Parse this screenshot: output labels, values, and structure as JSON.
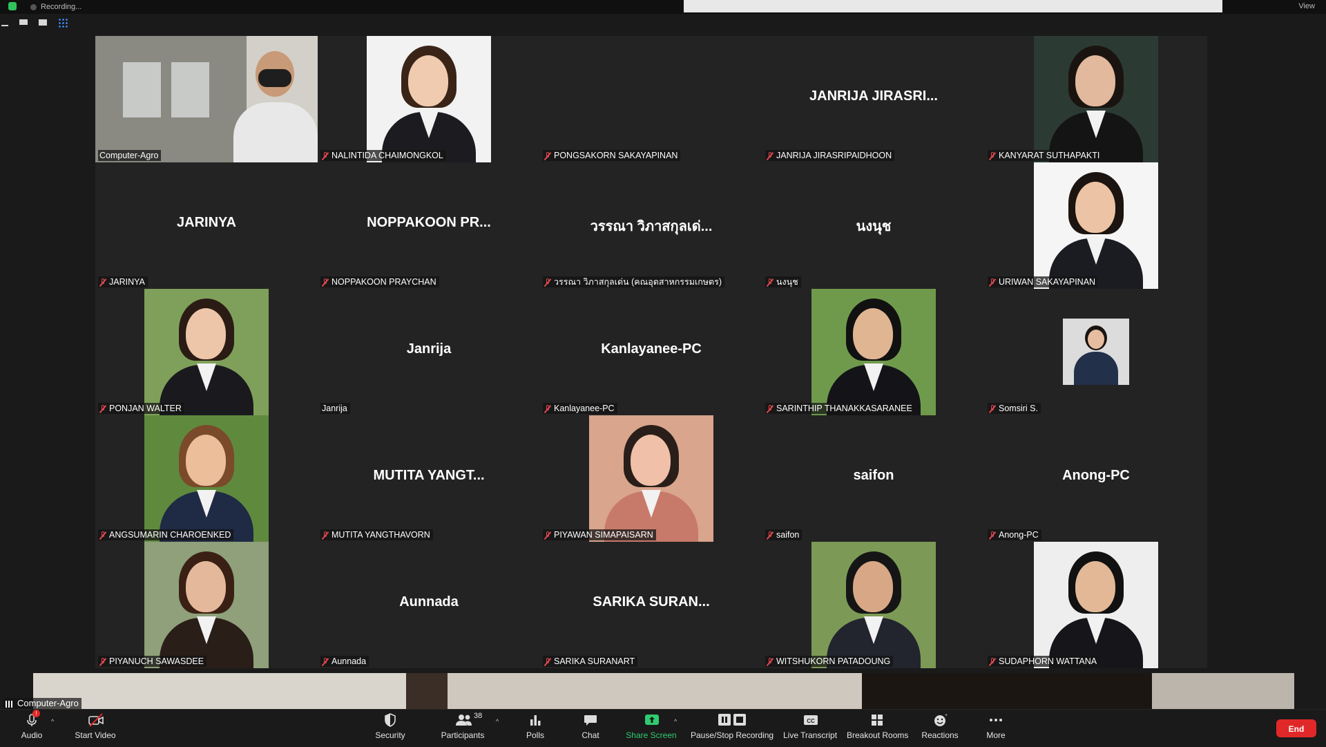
{
  "top": {
    "recording_label": "Recording...",
    "view_label": "View"
  },
  "participants": [
    {
      "name": "Computer-Agro",
      "display": "",
      "video": true,
      "muted": false,
      "active": true,
      "photo": "cctv",
      "pal": [
        "#8a8a82",
        "#3a3a3a",
        "#d7d9da"
      ]
    },
    {
      "name": "NALINTIDA CHAIMONGKOL",
      "display": "",
      "video": true,
      "muted": true,
      "photo": "woman",
      "pal": [
        "#f2f2f2",
        "#1c1c20",
        "#3a2418",
        "#f0cbb0"
      ]
    },
    {
      "name": "PONGSAKORN SAKAYAPINAN",
      "display": "",
      "video": false,
      "muted": true
    },
    {
      "name": "JANRIJA JIRASRIPAIDHOON",
      "display": "JANRIJA  JIRASRI...",
      "video": false,
      "muted": true
    },
    {
      "name": "KANYARAT SUTHAPAKTI",
      "display": "",
      "video": true,
      "muted": true,
      "photo": "woman",
      "pal": [
        "#2c3a34",
        "#141414",
        "#1a1410",
        "#e2b99c"
      ]
    },
    {
      "name": "JARINYA",
      "display": "JARINYA",
      "video": false,
      "muted": true
    },
    {
      "name": "NOPPAKOON PRAYCHAN",
      "display": "NOPPAKOON  PR...",
      "video": false,
      "muted": true
    },
    {
      "name": "วรรณา วิภาสกุลเด่น (คณอุตสาหกรรมเกษตร)",
      "display": "วรรณา  วิภาสกุลเด่...",
      "video": false,
      "muted": true
    },
    {
      "name": "นงนุช",
      "display": "นงนุช",
      "video": false,
      "muted": true
    },
    {
      "name": "URIWAN SAKAYAPINAN",
      "display": "",
      "video": true,
      "muted": true,
      "photo": "woman",
      "pal": [
        "#f5f5f5",
        "#1b1c22",
        "#1b1410",
        "#ecc3a4"
      ]
    },
    {
      "name": "PONJAN WALTER",
      "display": "",
      "video": true,
      "muted": true,
      "photo": "woman",
      "pal": [
        "#7fa05a",
        "#1a1a1e",
        "#2a1c14",
        "#edc5a8"
      ]
    },
    {
      "name": "Janrija",
      "display": "Janrija",
      "video": false,
      "muted": false
    },
    {
      "name": "Kanlayanee-PC",
      "display": "Kanlayanee-PC",
      "video": false,
      "muted": true
    },
    {
      "name": "SARINTHIP THANAKKASARANEE",
      "display": "",
      "video": true,
      "muted": true,
      "photo": "woman",
      "pal": [
        "#6f9a4c",
        "#141418",
        "#111",
        "#e0b592"
      ]
    },
    {
      "name": "Somsiri S.",
      "display": "",
      "video": true,
      "muted": true,
      "photo": "small",
      "pal": [
        "#dcdcdc",
        "#22304a",
        "#1a1410",
        "#e6bda0"
      ]
    },
    {
      "name": "ANGSUMARIN CHAROENKED",
      "display": "",
      "video": true,
      "muted": true,
      "photo": "woman",
      "pal": [
        "#5f8a3e",
        "#1f2a44",
        "#7a4a2a",
        "#ecbf9a"
      ]
    },
    {
      "name": "MUTITA YANGTHAVORN",
      "display": "MUTITA  YANGT...",
      "video": false,
      "muted": true
    },
    {
      "name": "PIYAWAN SIMAPAISARN",
      "display": "",
      "video": true,
      "muted": true,
      "photo": "woman",
      "pal": [
        "#d9a58c",
        "#c87a6a",
        "#2a1e1a",
        "#f0c0a8"
      ]
    },
    {
      "name": "saifon",
      "display": "saifon",
      "video": false,
      "muted": true
    },
    {
      "name": "Anong-PC",
      "display": "Anong-PC",
      "video": false,
      "muted": true
    },
    {
      "name": "PIYANUCH SAWASDEE",
      "display": "",
      "video": true,
      "muted": true,
      "photo": "woman",
      "pal": [
        "#8fa07a",
        "#2a1e18",
        "#3a2014",
        "#e4b89a"
      ]
    },
    {
      "name": "Aunnada",
      "display": "Aunnada",
      "video": false,
      "muted": true
    },
    {
      "name": "SARIKA  SURANART",
      "display": "SARIKA   SURAN...",
      "video": false,
      "muted": true
    },
    {
      "name": "WITSHUKORN PATADOUNG",
      "display": "",
      "video": true,
      "muted": true,
      "photo": "man",
      "pal": [
        "#7c9a56",
        "#22242e",
        "#151515",
        "#d8a886"
      ]
    },
    {
      "name": "SUDAPHORN WATTANA",
      "display": "",
      "video": true,
      "muted": true,
      "photo": "woman",
      "pal": [
        "#eeeeee",
        "#16161a",
        "#111",
        "#e2b896"
      ]
    }
  ],
  "self_view": {
    "name": "Computer-Agro"
  },
  "toolbar": {
    "audio": "Audio",
    "start_video": "Start Video",
    "security": "Security",
    "participants": "Participants",
    "participants_count": "38",
    "polls": "Polls",
    "chat": "Chat",
    "share_screen": "Share Screen",
    "recording": "Pause/Stop Recording",
    "live_transcript": "Live Transcript",
    "breakout_rooms": "Breakout Rooms",
    "reactions": "Reactions",
    "more": "More",
    "end": "End"
  },
  "colors": {
    "active_border": "#e8ec6a",
    "end_red": "#e02828",
    "share_green": "#2fcc71",
    "muted_red": "#e0484f"
  }
}
